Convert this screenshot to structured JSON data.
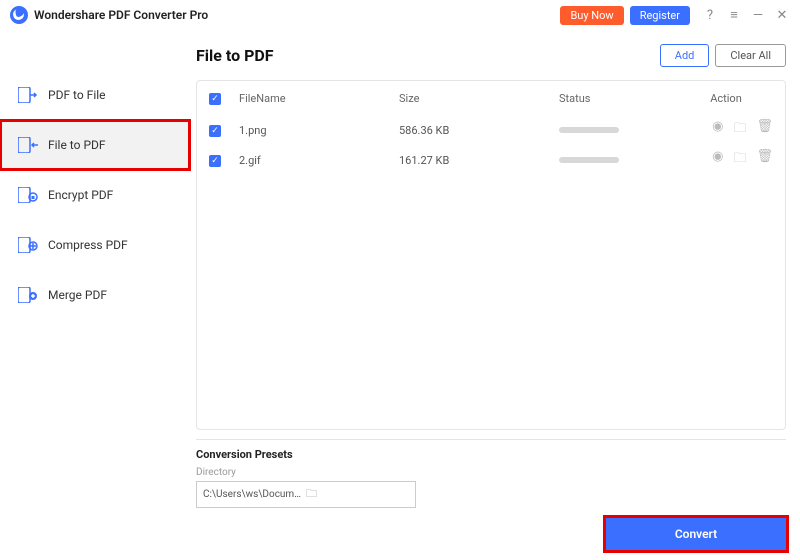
{
  "titlebar": {
    "appName": "Wondershare PDF Converter Pro",
    "buyNow": "Buy Now",
    "register": "Register"
  },
  "sidebar": {
    "items": [
      {
        "label": "PDF to File"
      },
      {
        "label": "File to PDF"
      },
      {
        "label": "Encrypt PDF"
      },
      {
        "label": "Compress PDF"
      },
      {
        "label": "Merge PDF"
      }
    ]
  },
  "header": {
    "title": "File to PDF",
    "add": "Add",
    "clearAll": "Clear All"
  },
  "table": {
    "columns": {
      "name": "FileName",
      "size": "Size",
      "status": "Status",
      "action": "Action"
    },
    "rows": [
      {
        "name": "1.png",
        "size": "586.36 KB"
      },
      {
        "name": "2.gif",
        "size": "161.27 KB"
      }
    ]
  },
  "presets": {
    "title": "Conversion Presets",
    "dirLabel": "Directory",
    "dirValue": "C:\\Users\\ws\\Documents\\PDFConvert"
  },
  "convert": {
    "label": "Convert"
  }
}
